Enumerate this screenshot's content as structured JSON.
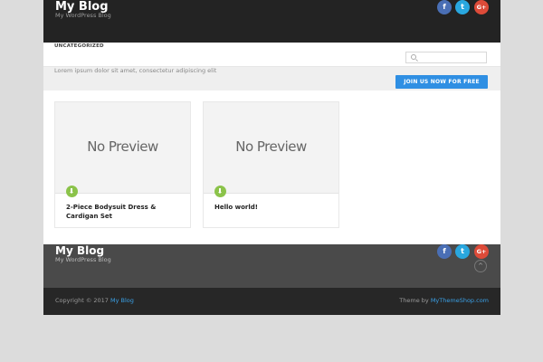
{
  "header": {
    "title": "My Blog",
    "description": "My WordPress Blog",
    "social": {
      "facebook": "f",
      "twitter": "t",
      "googleplus": "G+"
    }
  },
  "nav": {
    "items": [
      "UNCATEGORIZED"
    ]
  },
  "search": {
    "placeholder": "",
    "value": ""
  },
  "subheader": {
    "tagline": "Lorem ipsum dolor sit amet, consectetur adipiscing elit",
    "cta_label": "JOIN US NOW FOR FREE"
  },
  "posts": [
    {
      "thumb_text": "No Preview",
      "title": "2-Piece Bodysuit Dress & Cardigan Set"
    },
    {
      "thumb_text": "No Preview",
      "title": "Hello world!"
    }
  ],
  "footer": {
    "title": "My Blog",
    "description": "My WordPress Blog",
    "social": {
      "facebook": "f",
      "twitter": "t",
      "googleplus": "G+"
    },
    "to_top": "^"
  },
  "bottom": {
    "copyright_prefix": "Copyright © 2017 ",
    "copyright_link": "My Blog",
    "theme_prefix": "Theme by ",
    "theme_link": "MyThemeShop.com"
  },
  "colors": {
    "header_bg": "#232323",
    "accent_blue": "#2f8fe3",
    "download_green": "#8bc34a",
    "facebook": "#4a6fb5",
    "twitter": "#29a7df",
    "googleplus": "#dd4b39"
  }
}
